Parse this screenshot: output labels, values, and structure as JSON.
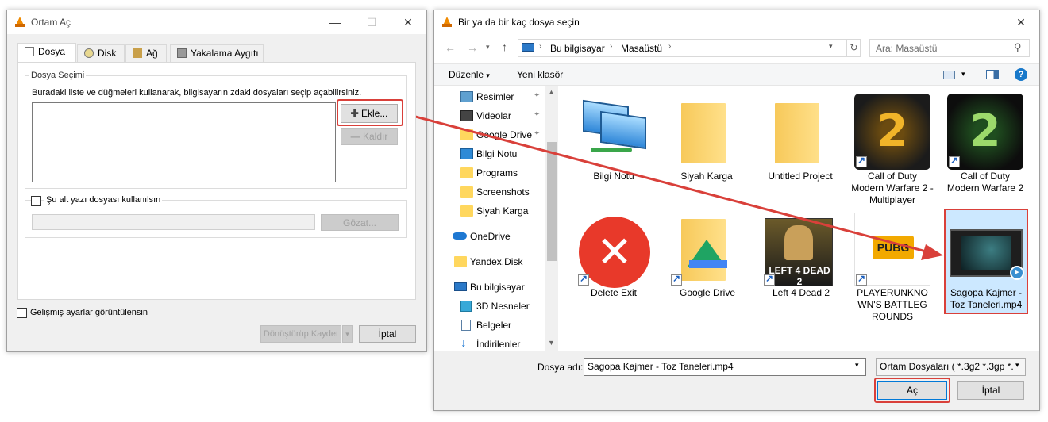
{
  "vlc_dialog": {
    "title": "Ortam Aç",
    "tabs": [
      {
        "label": "Dosya"
      },
      {
        "label": "Disk"
      },
      {
        "label": "Ağ"
      },
      {
        "label": "Yakalama Aygıtı"
      }
    ],
    "file_selection_group": "Dosya Seçimi",
    "file_selection_desc": "Buradaki liste ve düğmeleri kullanarak, bilgisayarınızdaki dosyaları seçip açabilirsiniz.",
    "add_button": "Ekle...",
    "remove_button": "Kaldır",
    "subtitle_checkbox": "Şu alt yazı dosyası kullanılsın",
    "browse_button": "Gözat...",
    "advanced_checkbox": "Gelişmiş ayarlar görüntülensin",
    "convert_button": "Dönüştürüp Kaydet",
    "cancel_button": "İptal"
  },
  "file_dialog": {
    "title": "Bir ya da bir kaç dosya seçin",
    "breadcrumb": [
      "Bu bilgisayar",
      "Masaüstü"
    ],
    "search_placeholder": "Ara: Masaüstü",
    "toolbar": {
      "organize": "Düzenle",
      "new_folder": "Yeni klasör"
    },
    "sidebar": [
      {
        "label": "Resimler",
        "icon": "pictures-icon",
        "pinned": true
      },
      {
        "label": "Videolar",
        "icon": "videos-icon",
        "pinned": true
      },
      {
        "label": "Google Drive",
        "icon": "folder-icon",
        "pinned": true
      },
      {
        "label": "Bilgi Notu",
        "icon": "app-icon"
      },
      {
        "label": "Programs",
        "icon": "folder-icon"
      },
      {
        "label": "Screenshots",
        "icon": "folder-icon"
      },
      {
        "label": "Siyah Karga",
        "icon": "folder-icon"
      },
      {
        "label": "OneDrive",
        "icon": "cloud-icon"
      },
      {
        "label": "Yandex.Disk",
        "icon": "folder-icon"
      },
      {
        "label": "Bu bilgisayar",
        "icon": "computer-icon"
      },
      {
        "label": "3D Nesneler",
        "icon": "cube-icon"
      },
      {
        "label": "Belgeler",
        "icon": "documents-icon"
      },
      {
        "label": "İndirilenler",
        "icon": "download-icon"
      }
    ],
    "files": [
      {
        "label": "Bilgi Notu",
        "icon": "computers-icon"
      },
      {
        "label": "Siyah Karga",
        "icon": "folder-icon"
      },
      {
        "label": "Untitled Project",
        "icon": "folder-icon"
      },
      {
        "label": "Call of Duty Modern Warfare 2 - Multiplayer",
        "icon": "cod-mp-icon"
      },
      {
        "label": "Call of Duty Modern Warfare 2",
        "icon": "cod-icon"
      },
      {
        "label": "Delete Exit",
        "icon": "delete-icon"
      },
      {
        "label": "Google Drive",
        "icon": "google-drive-folder-icon"
      },
      {
        "label": "Left 4 Dead 2",
        "icon": "l4d2-icon"
      },
      {
        "label": "PLAYERUNKNOWN'S BATTLEGROUNDS",
        "icon": "pubg-icon"
      },
      {
        "label": "Sagopa Kajmer - Toz Taneleri.mp4",
        "icon": "video-file-icon",
        "selected": true
      }
    ],
    "filename_label": "Dosya adı:",
    "filename_value": "Sagopa Kajmer - Toz Taneleri.mp4",
    "filetype_value": "Ortam Dosyaları ( *.3g2 *.3gp *.",
    "open_button": "Aç",
    "cancel_button": "İptal"
  },
  "colors": {
    "highlight": "#d9403a",
    "accent": "#1979ca"
  }
}
